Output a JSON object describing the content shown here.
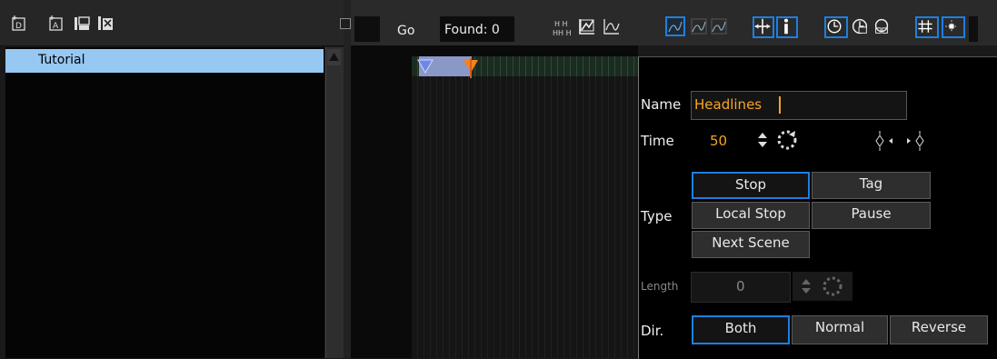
{
  "left_toolbar": {
    "icons": [
      "add-director-icon",
      "add-actor-icon",
      "add-point-icon",
      "delete-point-icon"
    ]
  },
  "tree": {
    "items": [
      {
        "label": "Tutorial",
        "selected": true
      }
    ]
  },
  "timeline_toolbar": {
    "go_label": "Go",
    "found_label": "Found: 0",
    "icons": [
      "expand-frames-icon",
      "graph-icon",
      "curve-icon",
      "curve-select-icon-1",
      "curve-select-icon-2",
      "curve-select-icon-3",
      "move-icon",
      "info-icon",
      "clock-icon",
      "clock-partial-icon",
      "clock-group-icon",
      "grid-icon",
      "snap-icon"
    ]
  },
  "properties": {
    "name_label": "Name",
    "name_value": "Headlines",
    "time_label": "Time",
    "time_value": "50",
    "type_label": "Type",
    "type_buttons": [
      {
        "label": "Stop",
        "selected": true
      },
      {
        "label": "Tag",
        "selected": false
      },
      {
        "label": "Local Stop",
        "selected": false
      },
      {
        "label": "Pause",
        "selected": false
      },
      {
        "label": "Next Scene",
        "selected": false
      }
    ],
    "length_label": "Length",
    "length_value": "0",
    "dir_label": "Dir.",
    "dir_buttons": [
      {
        "label": "Both",
        "selected": true
      },
      {
        "label": "Normal",
        "selected": false
      },
      {
        "label": "Reverse",
        "selected": false
      }
    ]
  },
  "colors": {
    "accent": "#1e7fe0",
    "selection": "#96c8f2",
    "highlight_text": "#f5a623",
    "marker_blue": "#6f88e8",
    "marker_orange": "#f5821f"
  }
}
